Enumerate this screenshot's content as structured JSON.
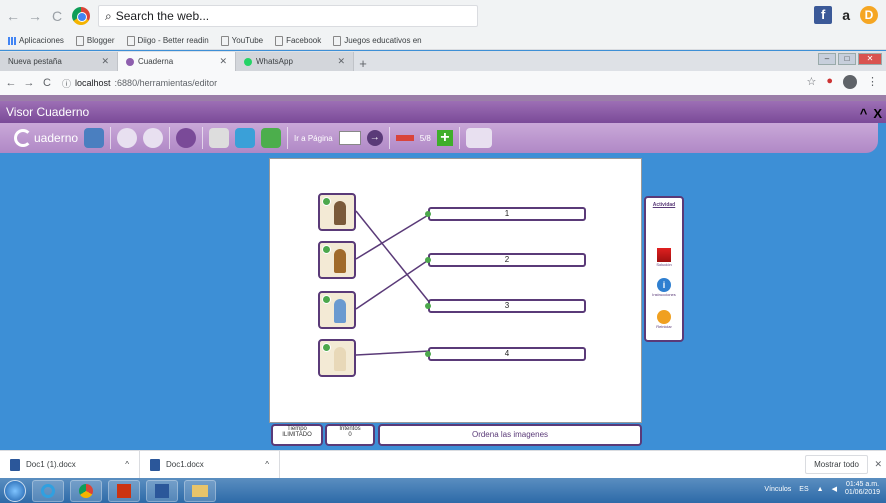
{
  "browser": {
    "search_placeholder": "Search the web...",
    "profile_letter": "a",
    "bookmarks": [
      "Aplicaciones",
      "Blogger",
      "Diigo - Better readin",
      "YouTube",
      "Facebook",
      "Juegos educativos en"
    ],
    "tabs": [
      {
        "label": "Nueva pestaña"
      },
      {
        "label": "Cuaderna"
      },
      {
        "label": "WhatsApp"
      }
    ],
    "url_host": "localhost",
    "url_path": ":6880/herramientas/editor"
  },
  "app": {
    "title": "Visor Cuaderno",
    "logo_text": "uaderno",
    "goto_label": "Ir a Página",
    "page_count": "5/8"
  },
  "worksheet": {
    "answers": [
      "1",
      "2",
      "3",
      "4"
    ],
    "side_panel": {
      "title": "Actividad",
      "items": [
        "Solución",
        "Instrucciones",
        "Reiniciar"
      ]
    },
    "footer": {
      "time_label": "Tiempo",
      "time_value": "ILIMITADO",
      "tries_label": "Intentos",
      "tries_value": "0",
      "instruction": "Ordena las imagenes"
    }
  },
  "downloads": {
    "items": [
      "Doc1 (1).docx",
      "Doc1.docx"
    ],
    "show_all": "Mostrar todo"
  },
  "taskbar": {
    "tray_label": "Vínculos",
    "lang": "ES",
    "time": "01:45 a.m.",
    "date": "01/06/2019"
  },
  "colors": {
    "purple_dark": "#5a3a78",
    "purple_bar": "#9d6fb5",
    "desktop_blue": "#3d8fd6"
  }
}
